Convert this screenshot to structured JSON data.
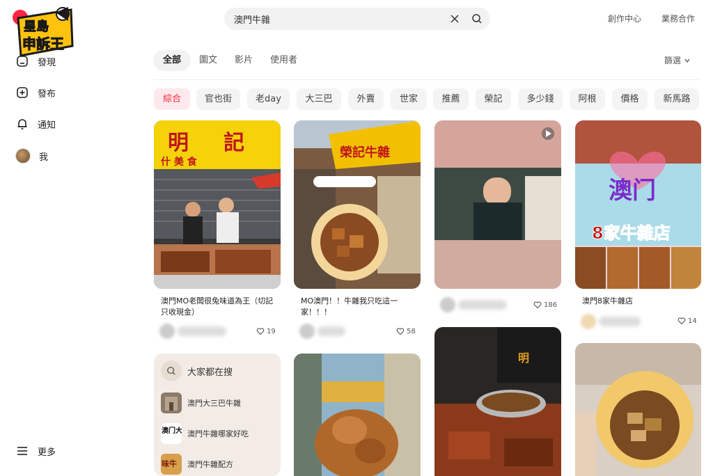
{
  "logo": {
    "text_line1": "星島",
    "text_line2": "申訴王"
  },
  "sidebar": {
    "items": [
      {
        "label": "發現",
        "icon": "home-icon"
      },
      {
        "label": "發布",
        "icon": "plus-square-icon"
      },
      {
        "label": "通知",
        "icon": "bell-icon"
      },
      {
        "label": "我",
        "icon": "avatar"
      }
    ],
    "more_label": "更多"
  },
  "search": {
    "query": "澳門牛雜"
  },
  "header": {
    "creator_center": "創作中心",
    "business": "業務合作"
  },
  "tabs": [
    "全部",
    "圖文",
    "影片",
    "使用者"
  ],
  "filter_label": "篩選",
  "chips": [
    "綜合",
    "官也街",
    "老day",
    "大三巴",
    "外賣",
    "世家",
    "推薦",
    "榮記",
    "多少錢",
    "阿根",
    "價格",
    "新馬路"
  ],
  "cards": [
    {
      "title": "澳門MO老闆很兔味道為王（切記只收現金）",
      "likes": "19"
    },
    {
      "title": "MO澳門！！牛雜我只吃這一家！！！",
      "likes": "58"
    },
    {
      "title": "",
      "likes": "186"
    },
    {
      "title": "澳門8家牛雜店",
      "likes": "14"
    }
  ],
  "card_texts": {
    "card1_sign_a": "明",
    "card1_sign_b": "記",
    "card1_sign_c": "什 美 食",
    "card2_sign": "榮記牛雜",
    "card4_line1": "澳门",
    "card4_line2": "8家牛雜店",
    "card6_sign": "明"
  },
  "trending": {
    "title": "大家都在搜",
    "items": [
      "澳門大三巴牛雜",
      "澳門牛雜哪家好吃",
      "澳門牛雜配方"
    ],
    "thumb_texts": [
      "",
      "澳门大三",
      "味牛"
    ]
  },
  "colors": {
    "accent": "#ff2741",
    "chip_bg": "#f4f4f4",
    "trend_bg": "#f3ece6"
  }
}
